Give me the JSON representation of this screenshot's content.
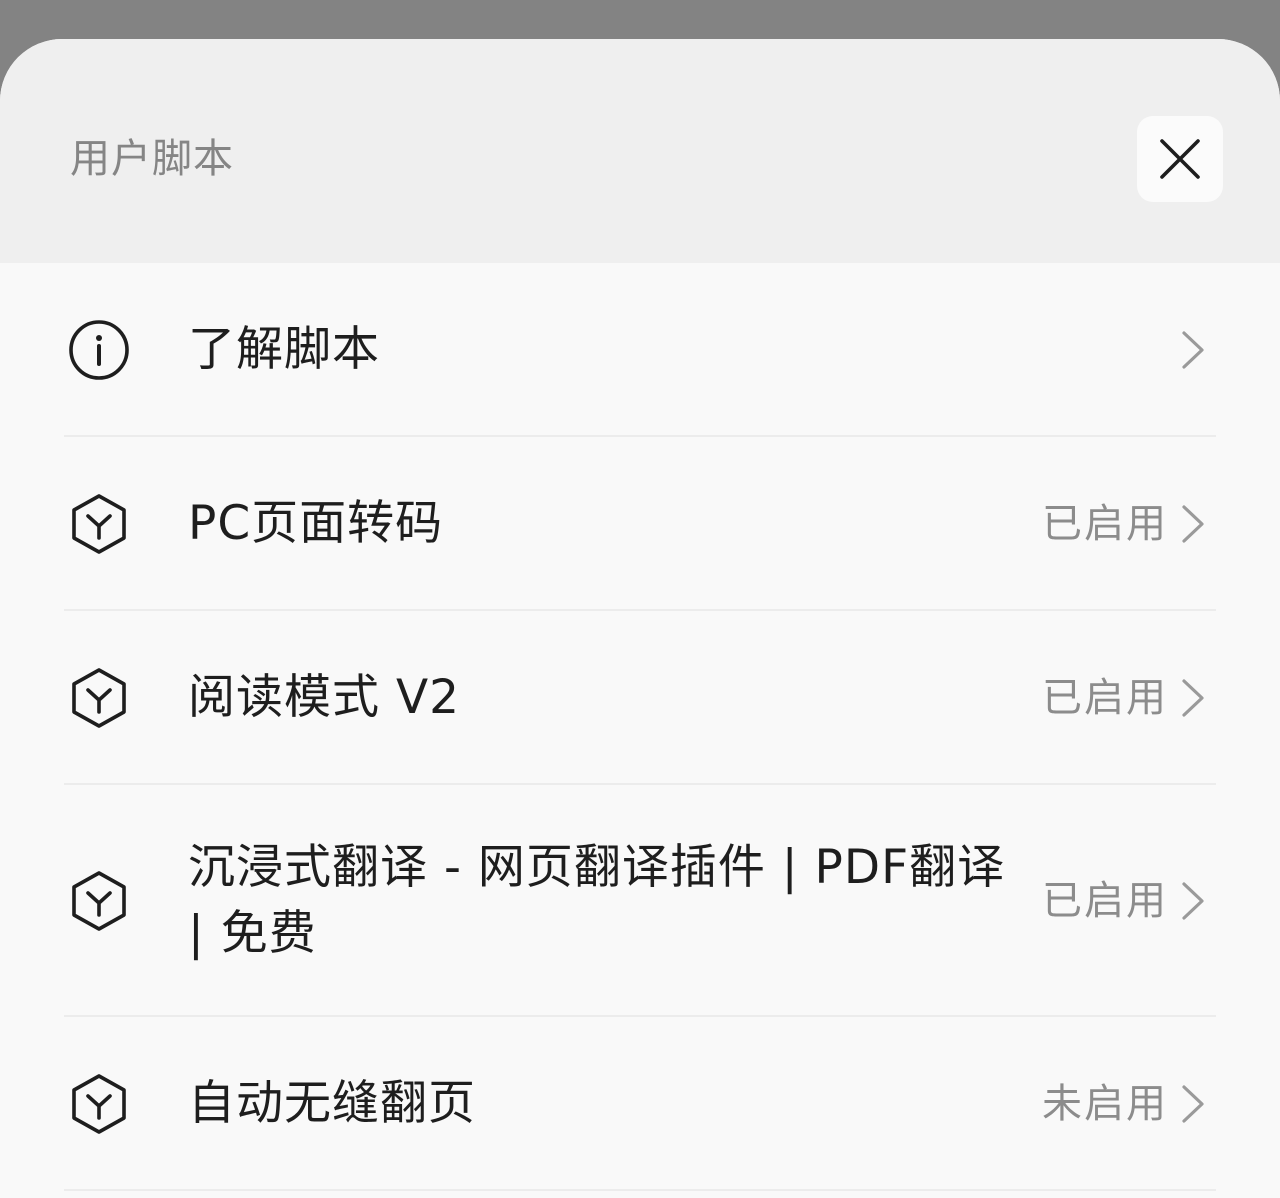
{
  "sheet": {
    "title": "用户脚本",
    "close_icon": "close-icon"
  },
  "items": [
    {
      "icon": "info-icon",
      "label": "了解脚本",
      "status": ""
    },
    {
      "icon": "script-cube-icon",
      "label": "PC页面转码",
      "status": "已启用"
    },
    {
      "icon": "script-cube-icon",
      "label": "阅读模式 V2",
      "status": "已启用"
    },
    {
      "icon": "script-cube-icon",
      "label": "沉浸式翻译 - 网页翻译插件 | PDF翻译 | 免费",
      "status": "已启用"
    },
    {
      "icon": "script-cube-icon",
      "label": "自动无缝翻页",
      "status": "未启用"
    }
  ],
  "colors": {
    "backdrop": "#838383",
    "sheet_bg": "#f9f9f9",
    "header_bg": "#efefef",
    "label_text": "#1e1e1e",
    "muted_text": "#8c8c8c"
  }
}
